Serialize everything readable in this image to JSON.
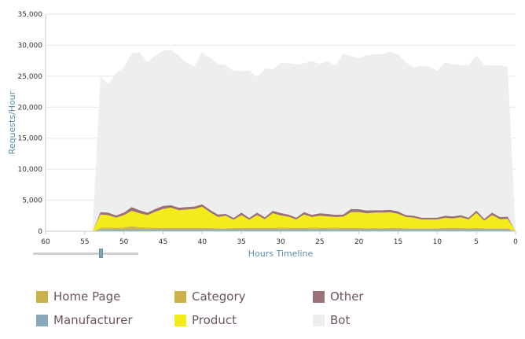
{
  "chart_data": {
    "type": "area",
    "stacked": true,
    "title": "",
    "xlabel": "Hours Timeline",
    "ylabel": "Requests/Hour",
    "xlim": [
      60,
      0
    ],
    "ylim": [
      0,
      35000
    ],
    "x_ticks": [
      "60",
      "55",
      "50",
      "45",
      "40",
      "35",
      "30",
      "25",
      "20",
      "15",
      "10",
      "5",
      "0"
    ],
    "y_ticks": [
      "0",
      "5,000",
      "10,000",
      "15,000",
      "20,000",
      "25,000",
      "30,000",
      "35,000"
    ],
    "grid": "horizontal",
    "legend_position": "bottom",
    "x": [
      54,
      53,
      52,
      51,
      50,
      49,
      48,
      47,
      46,
      45,
      44,
      43,
      42,
      41,
      40,
      39,
      38,
      37,
      36,
      35,
      34,
      33,
      32,
      31,
      30,
      29,
      28,
      27,
      26,
      25,
      24,
      23,
      22,
      21,
      20,
      19,
      18,
      17,
      16,
      15,
      14,
      13,
      12,
      11,
      10,
      9,
      8,
      7,
      6,
      5,
      4,
      3,
      2,
      1,
      0
    ],
    "series": [
      {
        "name": "Manufacturer",
        "color": "#88a8b8",
        "values": [
          0,
          300,
          300,
          300,
          300,
          300,
          300,
          300,
          300,
          300,
          300,
          300,
          300,
          300,
          300,
          300,
          300,
          300,
          300,
          300,
          300,
          300,
          300,
          300,
          300,
          300,
          300,
          300,
          300,
          300,
          300,
          300,
          300,
          300,
          300,
          300,
          300,
          300,
          300,
          300,
          300,
          300,
          300,
          300,
          300,
          300,
          300,
          300,
          300,
          300,
          300,
          300,
          300,
          300,
          0
        ]
      },
      {
        "name": "Home Page",
        "color": "#c9b24a",
        "values": [
          0,
          150,
          200,
          150,
          200,
          400,
          250,
          200,
          150,
          150,
          150,
          150,
          150,
          150,
          150,
          150,
          100,
          100,
          150,
          150,
          150,
          150,
          150,
          150,
          200,
          150,
          150,
          150,
          200,
          150,
          150,
          200,
          150,
          150,
          150,
          100,
          150,
          100,
          150,
          150,
          100,
          100,
          100,
          100,
          100,
          150,
          150,
          150,
          100,
          150,
          100,
          100,
          100,
          100,
          0
        ]
      },
      {
        "name": "Category",
        "color": "#cdb048",
        "values": [
          0,
          100,
          100,
          100,
          100,
          100,
          100,
          100,
          100,
          100,
          100,
          100,
          100,
          100,
          100,
          100,
          100,
          100,
          100,
          100,
          100,
          100,
          100,
          100,
          100,
          100,
          100,
          100,
          100,
          100,
          100,
          100,
          100,
          100,
          100,
          100,
          100,
          100,
          100,
          100,
          100,
          100,
          100,
          100,
          100,
          100,
          100,
          100,
          100,
          100,
          100,
          100,
          100,
          100,
          0
        ]
      },
      {
        "name": "Product",
        "color": "#f4ec1a",
        "values": [
          0,
          2150,
          2000,
          1650,
          2000,
          2500,
          2250,
          2000,
          2600,
          3050,
          3250,
          2850,
          2950,
          3050,
          3400,
          2500,
          1800,
          2000,
          1300,
          2050,
          1300,
          2050,
          1400,
          2350,
          1950,
          1800,
          1350,
          2150,
          1700,
          1950,
          1850,
          1700,
          1800,
          2550,
          2550,
          2400,
          2450,
          2500,
          2500,
          2250,
          1800,
          1700,
          1400,
          1400,
          1400,
          1600,
          1500,
          1700,
          1400,
          2400,
          1200,
          2100,
          1450,
          1500,
          0
        ]
      },
      {
        "name": "Other",
        "color": "#9b7178",
        "values": [
          0,
          400,
          400,
          350,
          400,
          600,
          500,
          400,
          450,
          500,
          400,
          400,
          400,
          400,
          400,
          400,
          400,
          300,
          300,
          400,
          300,
          400,
          300,
          400,
          400,
          350,
          300,
          400,
          350,
          400,
          400,
          350,
          350,
          500,
          450,
          450,
          400,
          400,
          400,
          400,
          300,
          300,
          300,
          300,
          300,
          350,
          350,
          350,
          300,
          400,
          300,
          400,
          350,
          350,
          0
        ]
      },
      {
        "name": "Bot",
        "color": "#eeeeee",
        "values": [
          0,
          21900,
          20700,
          22900,
          23400,
          24800,
          25400,
          24300,
          24700,
          25000,
          25100,
          24500,
          23300,
          22600,
          24500,
          24500,
          24300,
          24000,
          23700,
          22800,
          23800,
          21800,
          24000,
          22800,
          24200,
          24400,
          24700,
          24000,
          24800,
          24100,
          24600,
          24100,
          26000,
          24600,
          24400,
          25100,
          25100,
          25200,
          25500,
          25300,
          24600,
          23900,
          24500,
          24300,
          23700,
          24700,
          24500,
          24200,
          24600,
          25000,
          24800,
          23700,
          24500,
          24100,
          0
        ]
      }
    ]
  },
  "legend": {
    "items": [
      {
        "label": "Home Page",
        "color": "#c9b24a"
      },
      {
        "label": "Category",
        "color": "#cdb048"
      },
      {
        "label": "Other",
        "color": "#9b7178"
      },
      {
        "label": "Manufacturer",
        "color": "#88a8b8"
      },
      {
        "label": "Product",
        "color": "#f4ec1a"
      },
      {
        "label": "Bot",
        "color": "#eeeeee"
      }
    ]
  },
  "slider": {
    "value_fraction": 0.65
  }
}
